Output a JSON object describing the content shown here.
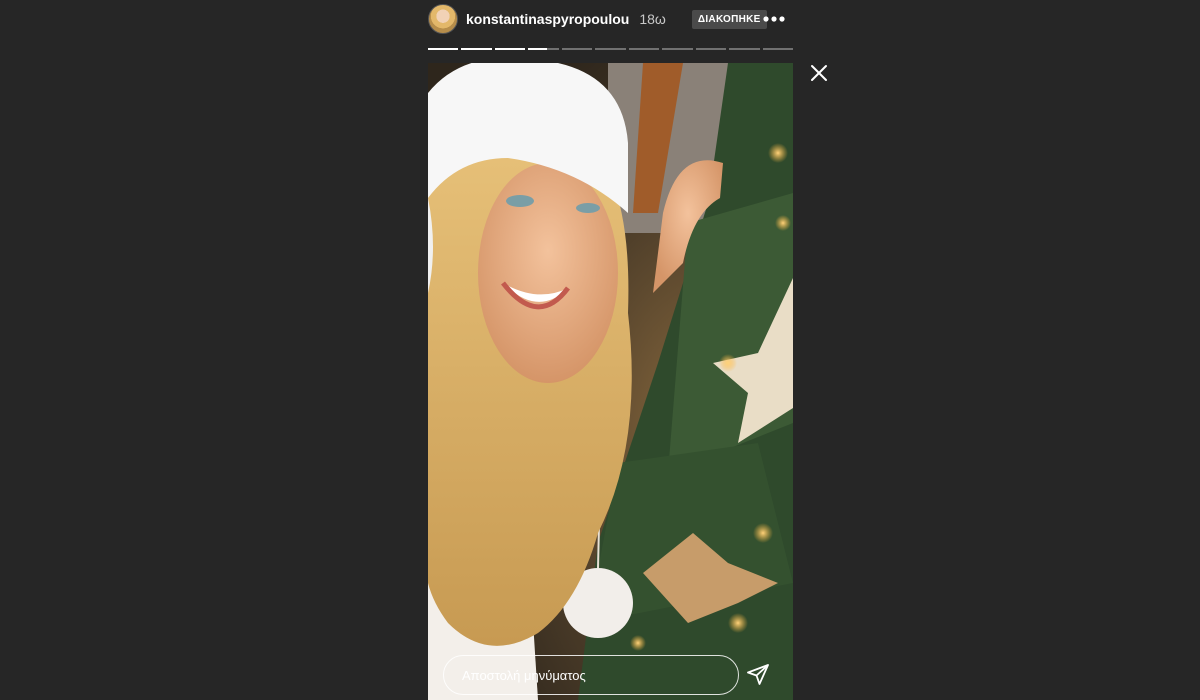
{
  "story": {
    "username": "konstantinaspyropoulou",
    "timestamp": "18ω",
    "status_badge": "ΔΙΑΚΟΠΗΚΕ",
    "segments_total": 11,
    "segments_completed": 3,
    "current_segment_progress": 0.6
  },
  "reply": {
    "placeholder": "Αποστολή μηνύματος"
  },
  "icons": {
    "more": "more-horizontal-icon",
    "close": "close-icon",
    "send": "paper-plane-icon"
  },
  "colors": {
    "background": "#262626",
    "text": "#ffffff",
    "badge": "#4a4a4a"
  }
}
